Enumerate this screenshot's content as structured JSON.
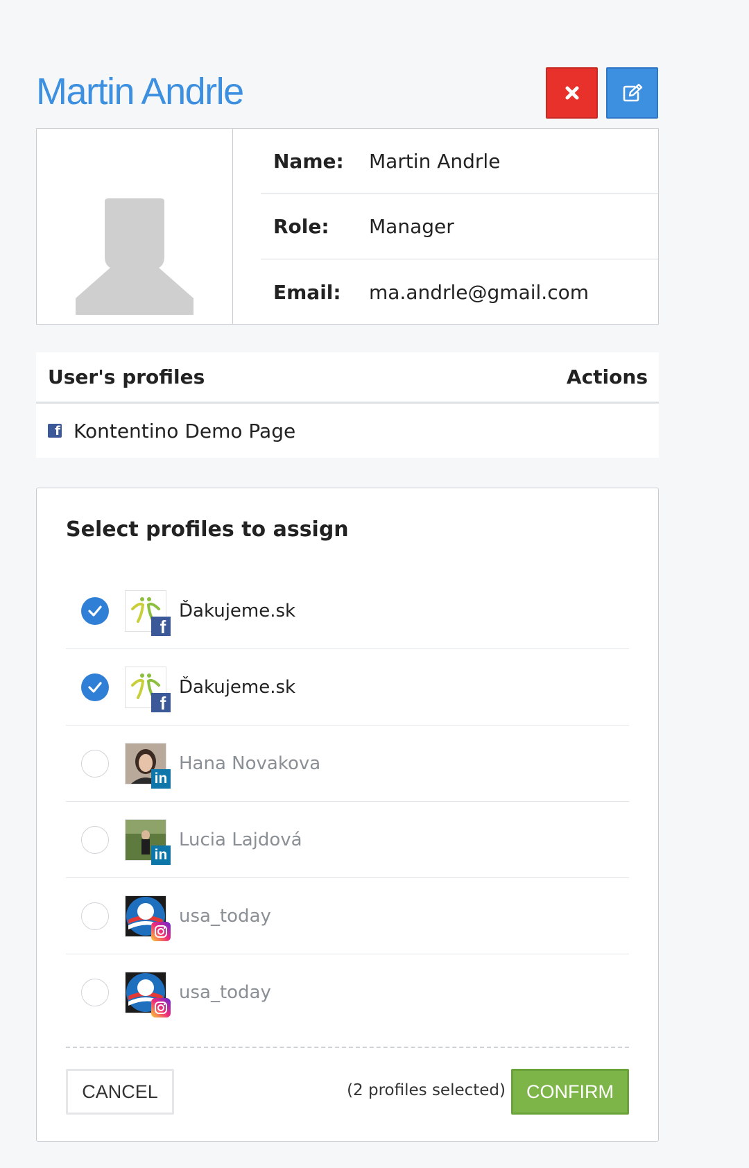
{
  "page": {
    "title": "Martin Andrle"
  },
  "header": {
    "delete_icon": "close-icon",
    "edit_icon": "edit-icon"
  },
  "user": {
    "avatar_icon": "user-placeholder-icon",
    "name_label": "Name:",
    "name_value": "Martin Andrle",
    "role_label": "Role:",
    "role_value": "Manager",
    "email_label": "Email:",
    "email_value": "ma.andrle@gmail.com"
  },
  "profiles": {
    "header_title": "User's profiles",
    "header_actions": "Actions",
    "rows": [
      {
        "network": "facebook",
        "name": "Kontentino Demo Page"
      }
    ]
  },
  "assign": {
    "title": "Select profiles to assign",
    "items": [
      {
        "name": "Ďakujeme.sk",
        "network": "facebook",
        "selected": true
      },
      {
        "name": "Ďakujeme.sk",
        "network": "facebook",
        "selected": true
      },
      {
        "name": "Hana Novakova",
        "network": "linkedin",
        "selected": false
      },
      {
        "name": "Lucia Lajdová",
        "network": "linkedin",
        "selected": false
      },
      {
        "name": "usa_today",
        "network": "instagram",
        "selected": false
      },
      {
        "name": "usa_today",
        "network": "instagram",
        "selected": false
      }
    ],
    "cancel_label": "CANCEL",
    "selected_count": "(2 profiles selected)",
    "confirm_label": "CONFIRM"
  },
  "colors": {
    "accent": "#3d8fe0",
    "delete": "#e8312a",
    "confirm": "#7db548",
    "facebook": "#3b5998",
    "linkedin": "#0e76a8"
  }
}
